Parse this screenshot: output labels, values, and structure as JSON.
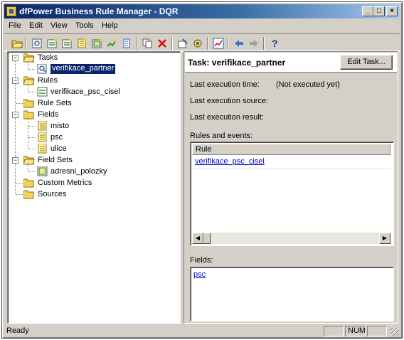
{
  "window": {
    "title": "dfPower Business Rule Manager - DQR"
  },
  "title_buttons": {
    "minimize": "_",
    "maximize": "□",
    "close": "×"
  },
  "menu": [
    "File",
    "Edit",
    "View",
    "Tools",
    "Help"
  ],
  "toolbar_icons": [
    "open-folder-icon",
    "new-task-icon",
    "new-rule-icon",
    "new-rule-set-icon",
    "new-field-icon",
    "new-field-set-icon",
    "custom-metric-icon",
    "source-icon",
    "copy-icon",
    "delete-icon",
    "properties-icon",
    "run-icon",
    "chart-icon",
    "back-arrow-icon",
    "forward-arrow-icon",
    "help-icon"
  ],
  "tree": {
    "tasks": {
      "label": "Tasks",
      "items": [
        "verifikace_partner"
      ]
    },
    "rules": {
      "label": "Rules",
      "items": [
        "verifikace_psc_cisel"
      ]
    },
    "rule_sets": {
      "label": "Rule Sets"
    },
    "fields": {
      "label": "Fields",
      "items": [
        "misto",
        "psc",
        "ulice"
      ]
    },
    "field_sets": {
      "label": "Field Sets",
      "items": [
        "adresni_polozky"
      ]
    },
    "custom_metrics": {
      "label": "Custom Metrics"
    },
    "sources": {
      "label": "Sources"
    }
  },
  "task": {
    "title": "Task:  verifikace_partner",
    "edit_button": "Edit Task...",
    "last_execution_time_label": "Last execution time:",
    "last_execution_time_value": "(Not executed yet)",
    "last_execution_source_label": "Last execution source:",
    "last_execution_result_label": "Last execution result:",
    "rules_events_label": "Rules and events:",
    "rules_column_header": "Rule",
    "rules": [
      "verifikace_psc_cisel"
    ],
    "fields_label": "Fields:",
    "fields": [
      "psc"
    ]
  },
  "status": {
    "text": "Ready",
    "num": "NUM"
  },
  "colors": {
    "title_bar": "#0a246a",
    "selection": "#0a246a",
    "link": "#0000cc",
    "face": "#d4d0c8"
  }
}
